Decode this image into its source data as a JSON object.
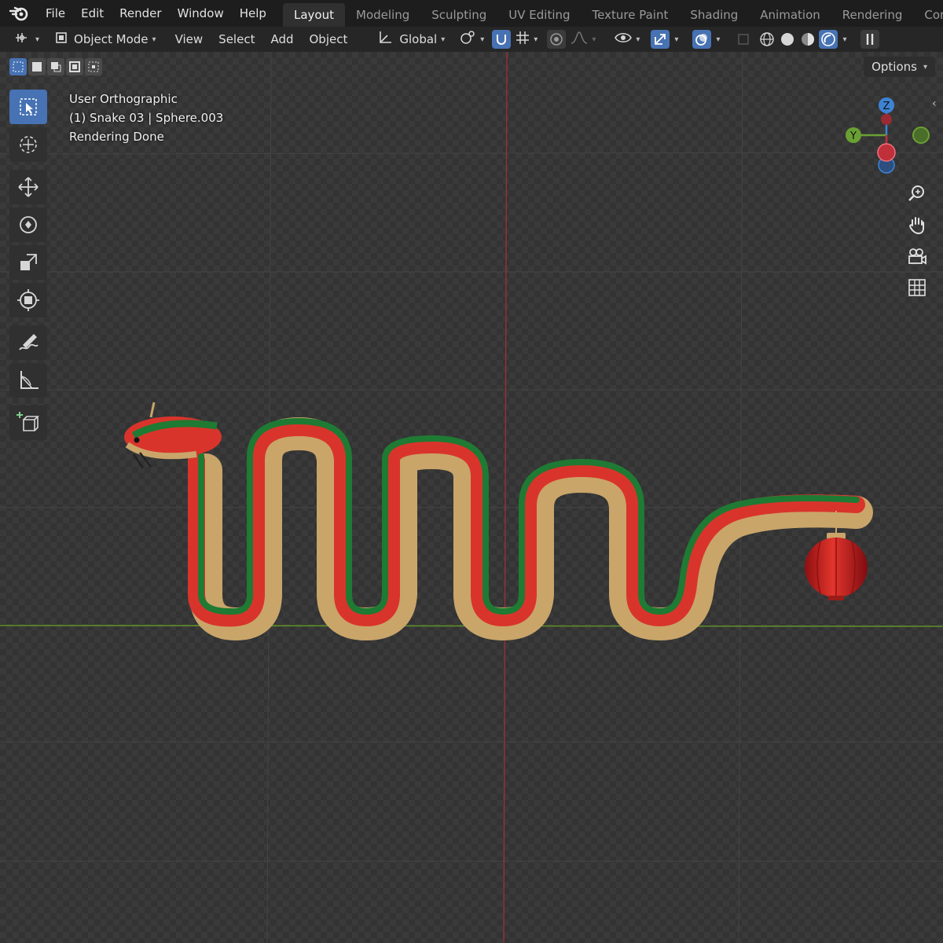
{
  "menu": {
    "items": [
      "File",
      "Edit",
      "Render",
      "Window",
      "Help"
    ]
  },
  "workspaces": {
    "tabs": [
      "Layout",
      "Modeling",
      "Sculpting",
      "UV Editing",
      "Texture Paint",
      "Shading",
      "Animation",
      "Rendering",
      "Comp"
    ],
    "active": "Layout"
  },
  "header": {
    "mode_label": "Object Mode",
    "view_label": "View",
    "select_label": "Select",
    "add_label": "Add",
    "object_label": "Object",
    "orientation_label": "Global"
  },
  "viewport": {
    "options_label": "Options",
    "overlay_lines": [
      "User Orthographic",
      "(1) Snake 03 | Sphere.003",
      "Rendering Done"
    ],
    "gizmo": {
      "z_label": "Z",
      "y_label": "Y"
    }
  },
  "colors": {
    "accent": "#4772b3",
    "x_axis": "#c0303a",
    "y_axis": "#6aa033",
    "z_axis": "#3d83d4",
    "snake_red": "#d9342b",
    "snake_green": "#1f7a33",
    "snake_gold": "#c9a56a"
  },
  "icons": {
    "tools": [
      "select-box-icon",
      "cursor-icon",
      "move-icon",
      "rotate-icon",
      "scale-icon",
      "transform-icon",
      "annotate-icon",
      "measure-icon",
      "add-cube-icon"
    ],
    "nav": [
      "zoom-icon",
      "pan-hand-icon",
      "camera-icon",
      "grid-icon"
    ]
  }
}
